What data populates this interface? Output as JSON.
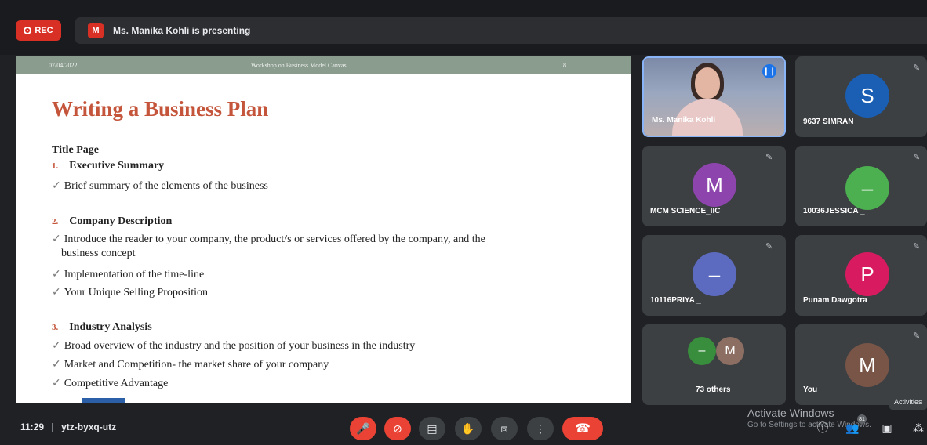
{
  "recording": {
    "label": "REC"
  },
  "presenter_banner": {
    "avatar_initial": "M",
    "text": "Ms. Manika Kohli is presenting"
  },
  "slide": {
    "header_date": "07/04/2022",
    "header_title": "Workshop on  Business Model Canvas",
    "header_page": "8",
    "title": "Writing a Business Plan",
    "lines": [
      {
        "num": "",
        "text": "Title Page"
      },
      {
        "num": "1.",
        "text": "Executive Summary"
      },
      {
        "check": "✓",
        "text": "Brief summary of the elements of the business"
      },
      {
        "num": "2.",
        "text": "Company Description"
      },
      {
        "check": "✓",
        "text": "Introduce the reader to your company, the product/s or services offered by the company, and the"
      },
      {
        "text": "business concept"
      },
      {
        "check": "✓",
        "text": "Implementation of the  time-line"
      },
      {
        "check": "✓",
        "text": "Your Unique Selling Proposition"
      },
      {
        "num": "3.",
        "text": "Industry Analysis"
      },
      {
        "check": "✓",
        "text": "Broad overview of the industry and the position of your business in the industry"
      },
      {
        "check": "✓",
        "text": "Market and Competition- the market share of your company"
      },
      {
        "check": "✓",
        "text": "Competitive Advantage"
      }
    ]
  },
  "participants": [
    {
      "name": "Ms. Manika Kohli",
      "initial": "",
      "color": ""
    },
    {
      "name": "9637 SIMRAN",
      "initial": "S",
      "color": "#1a5fb4"
    },
    {
      "name": "MCM SCIENCE_IIC",
      "initial": "M",
      "color": "#8e44ad"
    },
    {
      "name": "10036JESSICA _",
      "initial": "–",
      "color": "#4caf50"
    },
    {
      "name": "10116PRIYA _",
      "initial": "–",
      "color": "#5c6bc0"
    },
    {
      "name": "Punam Dawgotra",
      "initial": "P",
      "color": "#d81b60"
    },
    {
      "name": "73 others",
      "initial_a": "–",
      "color_a": "#388e3c",
      "initial_b": "M",
      "color_b": "#8d6e63"
    },
    {
      "name": "You",
      "initial": "M",
      "color": "#795548"
    }
  ],
  "bottom_bar": {
    "time": "11:29",
    "separator": "|",
    "meeting_code": "ytz-byxq-utz",
    "participant_count": "81"
  },
  "windows_watermark": {
    "line1": "Activate Windows",
    "line2": "Go to Settings to activate Windows."
  },
  "activities_tooltip": "Activities"
}
